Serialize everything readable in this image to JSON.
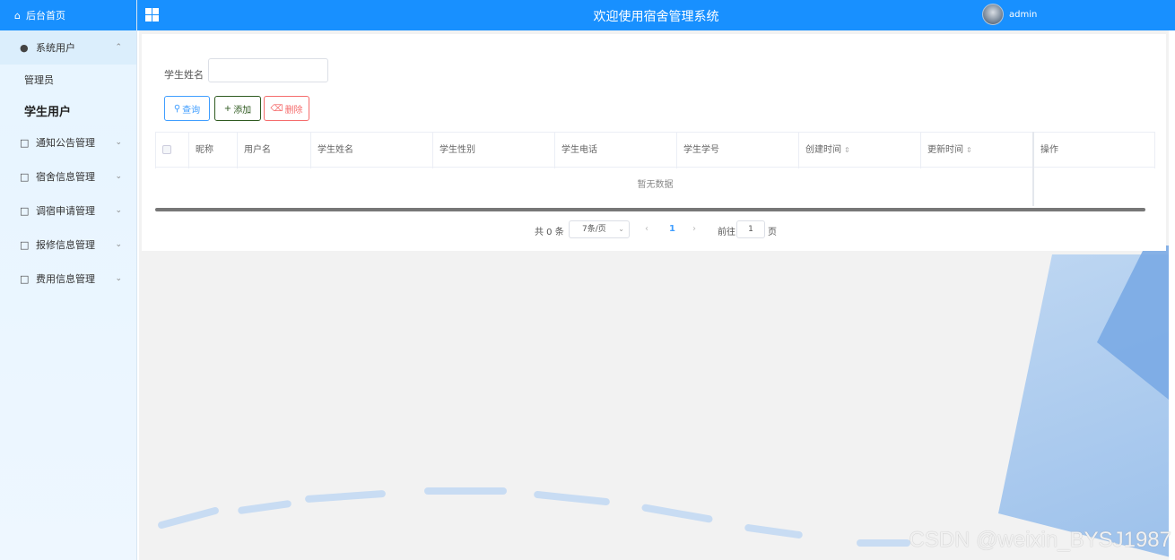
{
  "sidebar": {
    "home": "后台首页",
    "items": [
      {
        "label": "系统用户",
        "open": true,
        "children": [
          "管理员",
          "学生用户"
        ]
      },
      {
        "label": "通知公告管理"
      },
      {
        "label": "宿舍信息管理"
      },
      {
        "label": "调宿申请管理"
      },
      {
        "label": "报修信息管理"
      },
      {
        "label": "费用信息管理"
      }
    ]
  },
  "header": {
    "title": "欢迎使用宿舍管理系统",
    "user": "admin"
  },
  "search": {
    "label": "学生姓名",
    "value": ""
  },
  "buttons": {
    "query": "查询",
    "add": "添加",
    "delete": "删除"
  },
  "table": {
    "columns": [
      "昵称",
      "用户名",
      "学生姓名",
      "学生性别",
      "学生电话",
      "学生学号",
      "创建时间",
      "更新时间",
      "操作"
    ],
    "empty_text": "暂无数据"
  },
  "pagination": {
    "total": "共 0 条",
    "page_size": "7条/页",
    "current_page": "1",
    "goto_label": "前往",
    "goto_value": "1",
    "page_unit": "页"
  },
  "watermark": "CSDN @weixin_BYSJ1987",
  "colors": {
    "primary": "#1890ff",
    "danger": "#f56c6c",
    "success_dark": "#2f5a20"
  }
}
